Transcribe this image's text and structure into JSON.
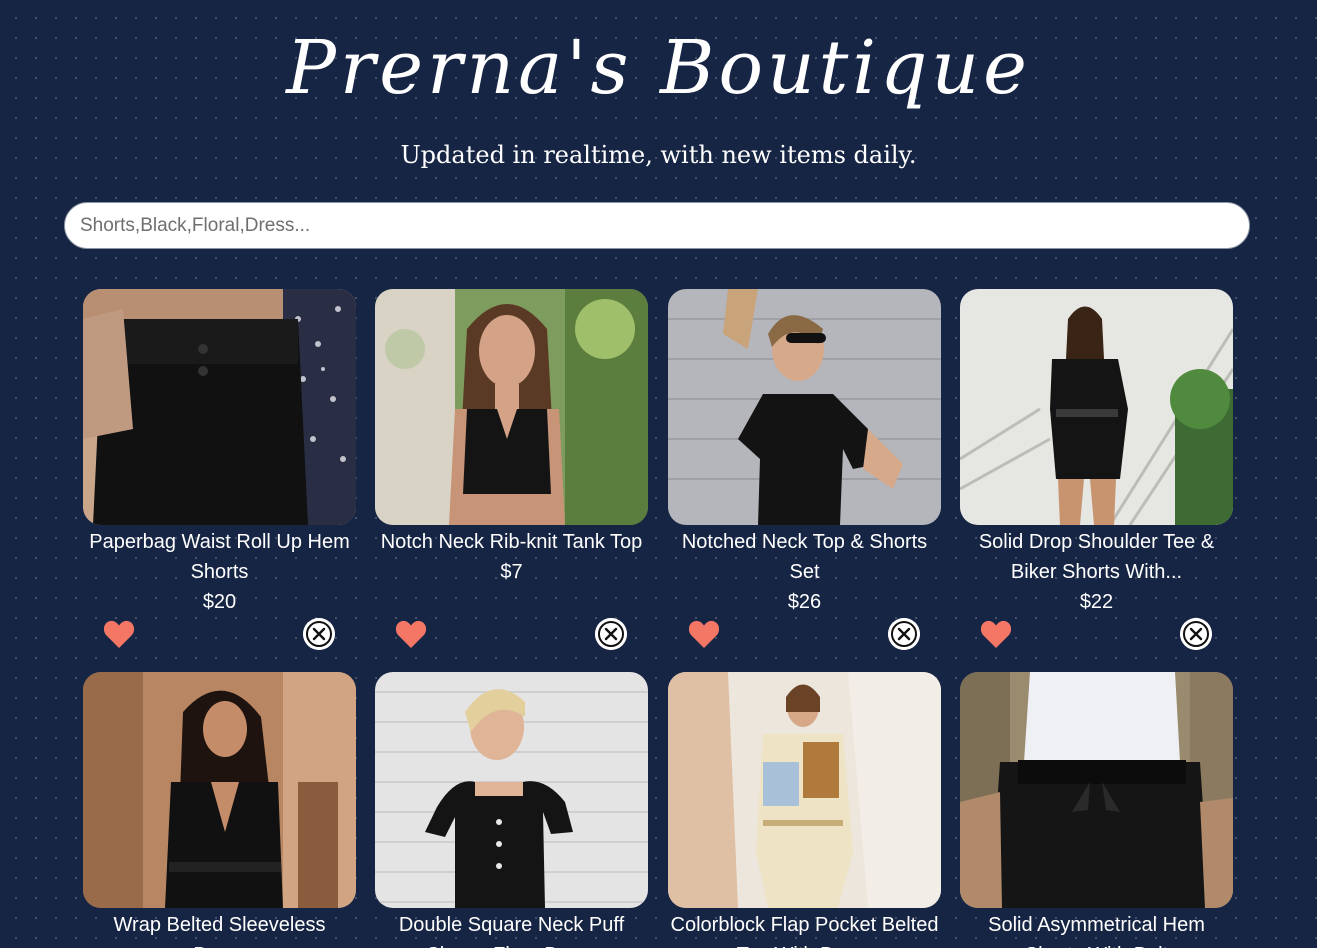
{
  "header": {
    "title": "Prerna's Boutique",
    "subtitle": "Updated in realtime, with new items daily."
  },
  "search": {
    "placeholder": "Shorts,Black,Floral,Dress...",
    "value": ""
  },
  "colors": {
    "background": "#172544",
    "heart": "#f47766",
    "close_bg": "#ffffff"
  },
  "products": [
    {
      "name": "Paperbag Waist Roll Up Hem Shorts",
      "price": "$20",
      "like_icon": "heart-icon",
      "dismiss_icon": "close-icon"
    },
    {
      "name": "Notch Neck Rib-knit Tank Top",
      "price": "$7",
      "like_icon": "heart-icon",
      "dismiss_icon": "close-icon"
    },
    {
      "name": "Notched Neck Top & Shorts Set",
      "price": "$26",
      "like_icon": "heart-icon",
      "dismiss_icon": "close-icon"
    },
    {
      "name": "Solid Drop Shoulder Tee & Biker Shorts With...",
      "price": "$22",
      "like_icon": "heart-icon",
      "dismiss_icon": "close-icon"
    },
    {
      "name": "Wrap Belted Sleeveless Dress",
      "price": "",
      "like_icon": "heart-icon",
      "dismiss_icon": "close-icon"
    },
    {
      "name": "Double Square Neck Puff Sleeve Flare Dress",
      "price": "",
      "like_icon": "heart-icon",
      "dismiss_icon": "close-icon"
    },
    {
      "name": "Colorblock Flap Pocket Belted Tee With Dress",
      "price": "",
      "like_icon": "heart-icon",
      "dismiss_icon": "close-icon"
    },
    {
      "name": "Solid Asymmetrical Hem Shorts With Belt",
      "price": "",
      "like_icon": "heart-icon",
      "dismiss_icon": "close-icon"
    }
  ]
}
